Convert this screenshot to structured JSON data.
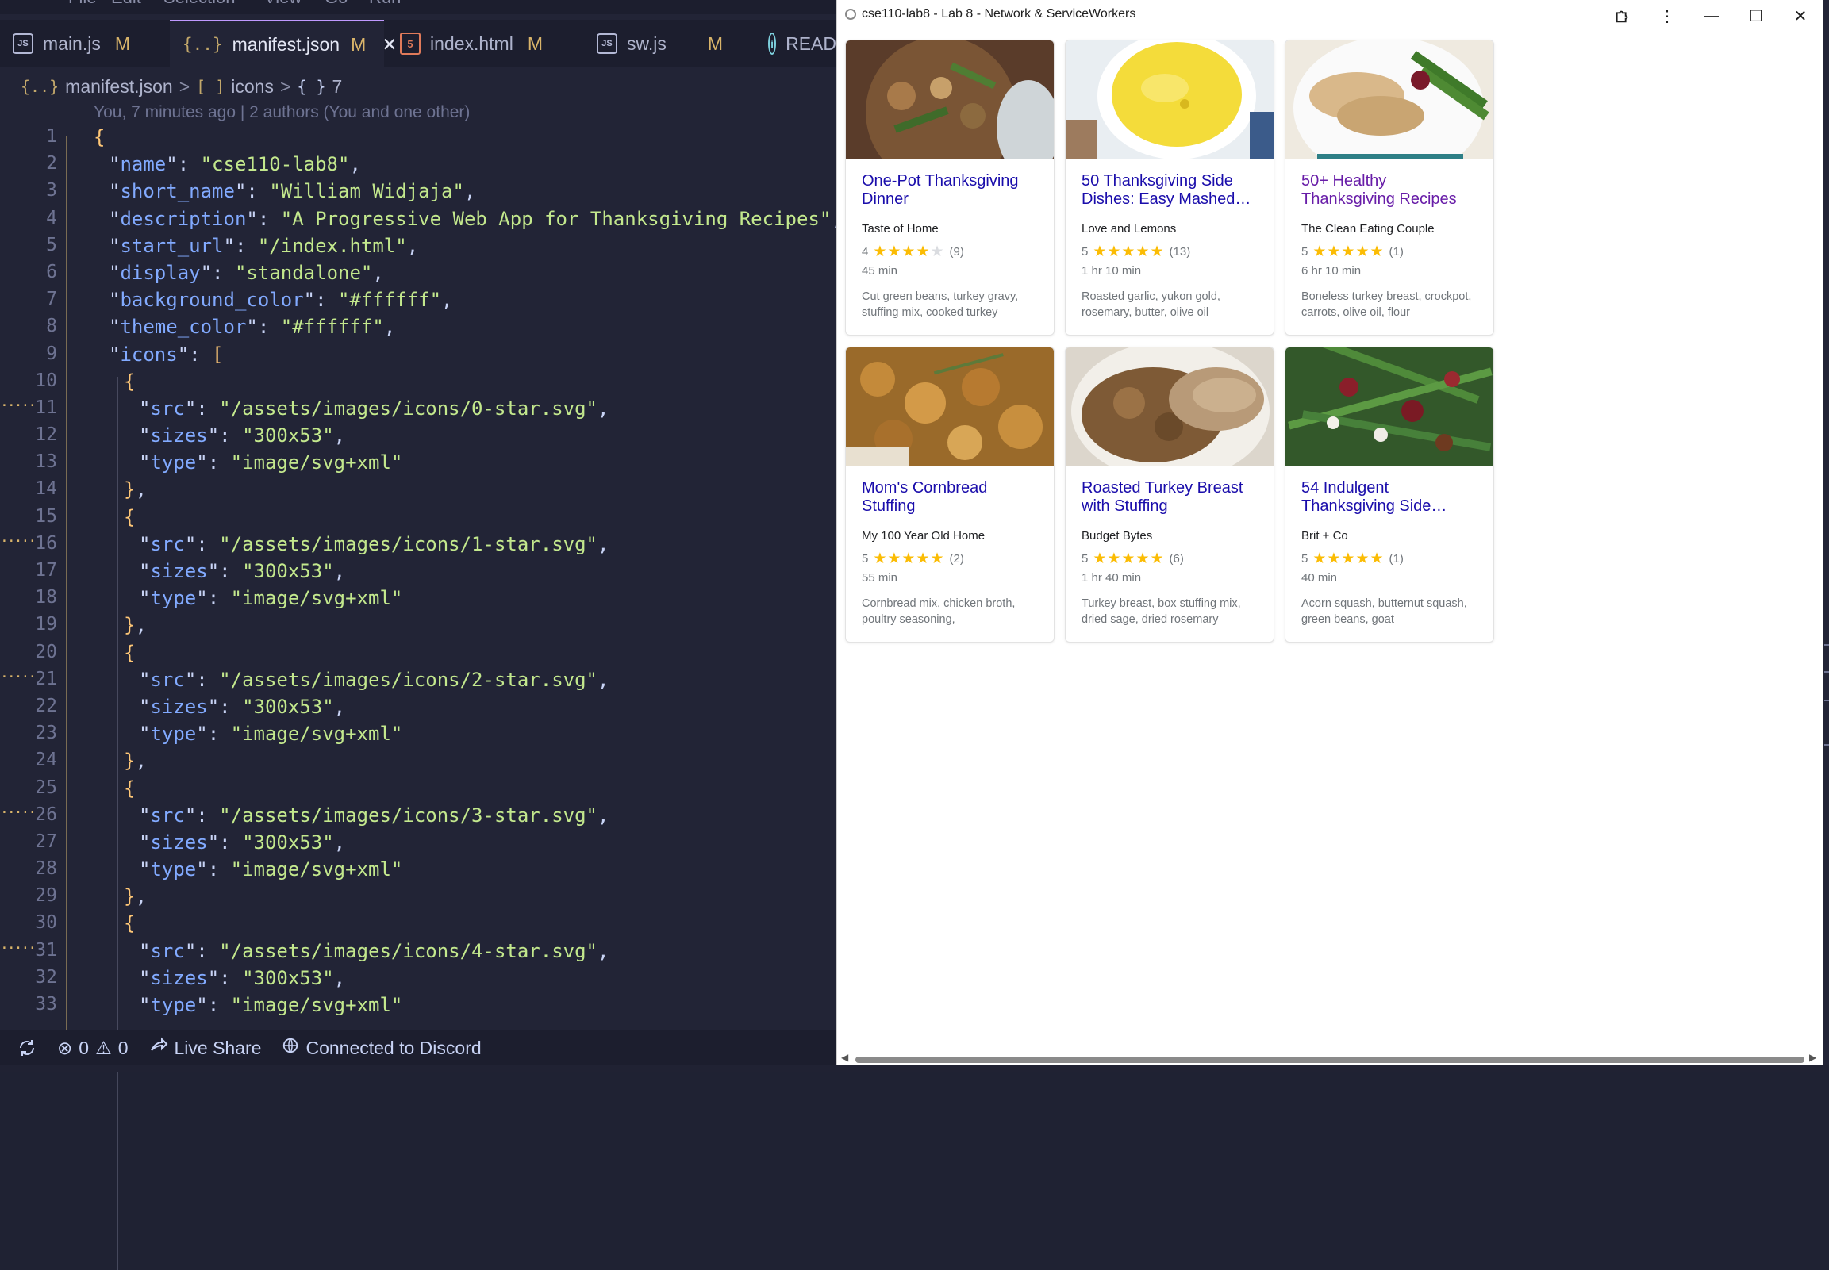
{
  "editor": {
    "menu": [
      "File",
      "Edit",
      "Selection",
      "View",
      "Go",
      "Run"
    ],
    "tabs": [
      {
        "label": "main.js",
        "badge": "JS",
        "status": "M",
        "active": false
      },
      {
        "label": "manifest.json",
        "badge": "{..}",
        "status": "M",
        "active": true,
        "close": "✕"
      },
      {
        "label": "index.html",
        "badge": "5",
        "status": "M",
        "active": false
      },
      {
        "label": "sw.js",
        "badge": "JS",
        "status": "M",
        "active": false
      },
      {
        "label": "READ",
        "badge": "i",
        "status": "",
        "active": false
      }
    ],
    "breadcrumb": {
      "file_icon": "{..}",
      "file": "manifest.json",
      "arr_icon": "[ ]",
      "arr": "icons",
      "obj_icon": "{ }",
      "obj": "7",
      "sep": ">"
    },
    "blame": "You, 7 minutes ago | 2 authors (You and one other)",
    "lines": [
      {
        "n": "1",
        "indent": 0,
        "parts": [
          [
            "b",
            "{"
          ]
        ]
      },
      {
        "n": "2",
        "indent": 1,
        "parts": [
          [
            "p",
            "\""
          ],
          [
            "k",
            "name"
          ],
          [
            "p",
            "\": "
          ],
          [
            "s",
            "\"cse110-lab8\""
          ],
          [
            "p",
            ","
          ]
        ]
      },
      {
        "n": "3",
        "indent": 1,
        "parts": [
          [
            "p",
            "\""
          ],
          [
            "k",
            "short_name"
          ],
          [
            "p",
            "\": "
          ],
          [
            "s",
            "\"William Widjaja\""
          ],
          [
            "p",
            ","
          ]
        ]
      },
      {
        "n": "4",
        "indent": 1,
        "parts": [
          [
            "p",
            "\""
          ],
          [
            "k",
            "description"
          ],
          [
            "p",
            "\": "
          ],
          [
            "s",
            "\"A Progressive Web App for Thanksgiving Recipes\""
          ],
          [
            "p",
            ","
          ]
        ]
      },
      {
        "n": "5",
        "indent": 1,
        "parts": [
          [
            "p",
            "\""
          ],
          [
            "k",
            "start_url"
          ],
          [
            "p",
            "\": "
          ],
          [
            "s",
            "\"/index.html\""
          ],
          [
            "p",
            ","
          ]
        ]
      },
      {
        "n": "6",
        "indent": 1,
        "parts": [
          [
            "p",
            "\""
          ],
          [
            "k",
            "display"
          ],
          [
            "p",
            "\": "
          ],
          [
            "s",
            "\"standalone\""
          ],
          [
            "p",
            ","
          ]
        ]
      },
      {
        "n": "7",
        "indent": 1,
        "parts": [
          [
            "p",
            "\""
          ],
          [
            "k",
            "background_color"
          ],
          [
            "p",
            "\": "
          ],
          [
            "s",
            "\"#ffffff\""
          ],
          [
            "p",
            ","
          ]
        ]
      },
      {
        "n": "8",
        "indent": 1,
        "parts": [
          [
            "p",
            "\""
          ],
          [
            "k",
            "theme_color"
          ],
          [
            "p",
            "\": "
          ],
          [
            "s",
            "\"#ffffff\""
          ],
          [
            "p",
            ","
          ]
        ]
      },
      {
        "n": "9",
        "indent": 1,
        "parts": [
          [
            "p",
            "\""
          ],
          [
            "k",
            "icons"
          ],
          [
            "p",
            "\": "
          ],
          [
            "b",
            "["
          ]
        ]
      },
      {
        "n": "10",
        "indent": 2,
        "parts": [
          [
            "b",
            "{"
          ]
        ]
      },
      {
        "n": "11",
        "indent": 3,
        "dots": true,
        "parts": [
          [
            "p",
            "\""
          ],
          [
            "k",
            "src"
          ],
          [
            "p",
            "\": "
          ],
          [
            "s",
            "\"/assets/images/icons/0-star.svg\""
          ],
          [
            "p",
            ","
          ]
        ]
      },
      {
        "n": "12",
        "indent": 3,
        "parts": [
          [
            "p",
            "\""
          ],
          [
            "k",
            "sizes"
          ],
          [
            "p",
            "\": "
          ],
          [
            "s",
            "\"300x53\""
          ],
          [
            "p",
            ","
          ]
        ]
      },
      {
        "n": "13",
        "indent": 3,
        "parts": [
          [
            "p",
            "\""
          ],
          [
            "k",
            "type"
          ],
          [
            "p",
            "\": "
          ],
          [
            "s",
            "\"image/svg+xml\""
          ]
        ]
      },
      {
        "n": "14",
        "indent": 2,
        "parts": [
          [
            "b",
            "}"
          ],
          [
            "p",
            ","
          ]
        ]
      },
      {
        "n": "15",
        "indent": 2,
        "parts": [
          [
            "b",
            "{"
          ]
        ]
      },
      {
        "n": "16",
        "indent": 3,
        "dots": true,
        "parts": [
          [
            "p",
            "\""
          ],
          [
            "k",
            "src"
          ],
          [
            "p",
            "\": "
          ],
          [
            "s",
            "\"/assets/images/icons/1-star.svg\""
          ],
          [
            "p",
            ","
          ]
        ]
      },
      {
        "n": "17",
        "indent": 3,
        "parts": [
          [
            "p",
            "\""
          ],
          [
            "k",
            "sizes"
          ],
          [
            "p",
            "\": "
          ],
          [
            "s",
            "\"300x53\""
          ],
          [
            "p",
            ","
          ]
        ]
      },
      {
        "n": "18",
        "indent": 3,
        "parts": [
          [
            "p",
            "\""
          ],
          [
            "k",
            "type"
          ],
          [
            "p",
            "\": "
          ],
          [
            "s",
            "\"image/svg+xml\""
          ]
        ]
      },
      {
        "n": "19",
        "indent": 2,
        "parts": [
          [
            "b",
            "}"
          ],
          [
            "p",
            ","
          ]
        ]
      },
      {
        "n": "20",
        "indent": 2,
        "parts": [
          [
            "b",
            "{"
          ]
        ]
      },
      {
        "n": "21",
        "indent": 3,
        "dots": true,
        "parts": [
          [
            "p",
            "\""
          ],
          [
            "k",
            "src"
          ],
          [
            "p",
            "\": "
          ],
          [
            "s",
            "\"/assets/images/icons/2-star.svg\""
          ],
          [
            "p",
            ","
          ]
        ]
      },
      {
        "n": "22",
        "indent": 3,
        "parts": [
          [
            "p",
            "\""
          ],
          [
            "k",
            "sizes"
          ],
          [
            "p",
            "\": "
          ],
          [
            "s",
            "\"300x53\""
          ],
          [
            "p",
            ","
          ]
        ]
      },
      {
        "n": "23",
        "indent": 3,
        "parts": [
          [
            "p",
            "\""
          ],
          [
            "k",
            "type"
          ],
          [
            "p",
            "\": "
          ],
          [
            "s",
            "\"image/svg+xml\""
          ]
        ]
      },
      {
        "n": "24",
        "indent": 2,
        "parts": [
          [
            "b",
            "}"
          ],
          [
            "p",
            ","
          ]
        ]
      },
      {
        "n": "25",
        "indent": 2,
        "parts": [
          [
            "b",
            "{"
          ]
        ]
      },
      {
        "n": "26",
        "indent": 3,
        "dots": true,
        "parts": [
          [
            "p",
            "\""
          ],
          [
            "k",
            "src"
          ],
          [
            "p",
            "\": "
          ],
          [
            "s",
            "\"/assets/images/icons/3-star.svg\""
          ],
          [
            "p",
            ","
          ]
        ]
      },
      {
        "n": "27",
        "indent": 3,
        "parts": [
          [
            "p",
            "\""
          ],
          [
            "k",
            "sizes"
          ],
          [
            "p",
            "\": "
          ],
          [
            "s",
            "\"300x53\""
          ],
          [
            "p",
            ","
          ]
        ]
      },
      {
        "n": "28",
        "indent": 3,
        "parts": [
          [
            "p",
            "\""
          ],
          [
            "k",
            "type"
          ],
          [
            "p",
            "\": "
          ],
          [
            "s",
            "\"image/svg+xml\""
          ]
        ]
      },
      {
        "n": "29",
        "indent": 2,
        "parts": [
          [
            "b",
            "}"
          ],
          [
            "p",
            ","
          ]
        ]
      },
      {
        "n": "30",
        "indent": 2,
        "parts": [
          [
            "b",
            "{"
          ]
        ]
      },
      {
        "n": "31",
        "indent": 3,
        "dots": true,
        "parts": [
          [
            "p",
            "\""
          ],
          [
            "k",
            "src"
          ],
          [
            "p",
            "\": "
          ],
          [
            "s",
            "\"/assets/images/icons/4-star.svg\""
          ],
          [
            "p",
            ","
          ]
        ]
      },
      {
        "n": "32",
        "indent": 3,
        "parts": [
          [
            "p",
            "\""
          ],
          [
            "k",
            "sizes"
          ],
          [
            "p",
            "\": "
          ],
          [
            "s",
            "\"300x53\""
          ],
          [
            "p",
            ","
          ]
        ]
      },
      {
        "n": "33",
        "indent": 3,
        "parts": [
          [
            "p",
            "\""
          ],
          [
            "k",
            "type"
          ],
          [
            "p",
            "\": "
          ],
          [
            "s",
            "\"image/svg+xml\""
          ]
        ]
      }
    ],
    "status": {
      "sync_icon": "sync-icon",
      "errors": "0",
      "warnings": "0",
      "live_share": "Live Share",
      "discord": "Connected to Discord"
    }
  },
  "browser": {
    "title": "cse110-lab8 - Lab 8 - Network & ServiceWorkers",
    "controls": {
      "extension": "puzzle-icon",
      "menu": "⋮",
      "minimize": "—",
      "maximize": "☐",
      "close": "✕"
    },
    "cards": [
      {
        "title": "One-Pot Thanksgiving Dinner",
        "visited": false,
        "source": "Taste of Home",
        "rating": "4",
        "stars": 4,
        "reviews": "(9)",
        "time": "45 min",
        "ingredients": "Cut green beans, turkey gravy, stuffing mix, cooked turkey",
        "photo": "stuffing-bowl"
      },
      {
        "title": "50 Thanksgiving Side Dishes: Easy Mashed…",
        "visited": false,
        "source": "Love and Lemons",
        "rating": "5",
        "stars": 5,
        "reviews": "(13)",
        "time": "1 hr 10 min",
        "ingredients": "Roasted garlic, yukon gold, rosemary, butter, olive oil",
        "photo": "mashed-potatoes"
      },
      {
        "title": "50+ Healthy Thanksgiving Recipes",
        "visited": true,
        "source": "The Clean Eating Couple",
        "rating": "5",
        "stars": 5,
        "reviews": "(1)",
        "time": "6 hr 10 min",
        "ingredients": "Boneless turkey breast, crockpot, carrots, olive oil, flour",
        "photo": "turkey-green-beans"
      },
      {
        "title": "Mom's Cornbread Stuffing",
        "visited": false,
        "source": "My 100 Year Old Home",
        "rating": "5",
        "stars": 5,
        "reviews": "(2)",
        "time": "55 min",
        "ingredients": "Cornbread mix, chicken broth, poultry seasoning,",
        "photo": "cornbread-stuffing"
      },
      {
        "title": "Roasted Turkey Breast with Stuffing",
        "visited": false,
        "source": "Budget Bytes",
        "rating": "5",
        "stars": 5,
        "reviews": "(6)",
        "time": "1 hr 40 min",
        "ingredients": "Turkey breast, box stuffing mix, dried sage, dried rosemary",
        "photo": "turkey-stuffing"
      },
      {
        "title": "54 Indulgent Thanksgiving Side…",
        "visited": false,
        "source": "Brit + Co",
        "rating": "5",
        "stars": 5,
        "reviews": "(1)",
        "time": "40 min",
        "ingredients": "Acorn squash, butternut squash, green beans, goat",
        "photo": "green-beans-cranberry"
      }
    ]
  },
  "colors": {
    "editor_bg": "#222436",
    "keyword": "#82aaff",
    "string": "#c3e88d",
    "bracket": "#ffc777",
    "link": "#1a0dab",
    "visited": "#681da8",
    "star": "#fbbc04"
  }
}
